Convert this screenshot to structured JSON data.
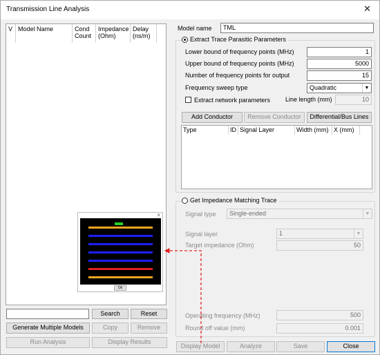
{
  "window": {
    "title": "Transmission Line Analysis",
    "close_glyph": "✕"
  },
  "model_list": {
    "columns": [
      "V",
      "Model Name",
      "Cond Count",
      "Impedance (Ohm)",
      "Delay (ns/m)"
    ]
  },
  "left_controls": {
    "search_value": "",
    "search_label": "Search",
    "reset_label": "Reset",
    "generate_label": "Generate Multiple Models",
    "copy_label": "Copy",
    "remove_label": "Remove",
    "run_label": "Run Analysis",
    "display_results_label": "Display Results"
  },
  "preview": {
    "close_glyph": "×",
    "ok_label": "Ok",
    "trace_colors": [
      "#f5a623",
      "#1f1fff",
      "#1f1fff",
      "#1f1fff",
      "#1f1fff",
      "#e02020",
      "#f5a623"
    ]
  },
  "model": {
    "label": "Model name",
    "value": "TML"
  },
  "extract": {
    "radio_label": "Extract Trace Parasitic Parameters",
    "lower_label": "Lower bound of frequency points (MHz)",
    "lower_value": "1",
    "upper_label": "Upper bound of frequency points (MHz)",
    "upper_value": "5000",
    "count_label": "Number of frequency points for output",
    "count_value": "15",
    "sweep_label": "Frequency sweep type",
    "sweep_value": "Quadratic",
    "network_label": "Extract network parameters",
    "line_length_label": "Line length (mm)",
    "line_length_value": "10",
    "add_conductor": "Add Conductor",
    "remove_conductor": "Remove Conductor",
    "diff_bus": "Differential/Bus Lines",
    "columns": [
      "Type",
      "ID",
      "Signal Layer",
      "Width (mm)",
      "X (mm)"
    ]
  },
  "impedance": {
    "radio_label": "Get Impedance Matching Trace",
    "signal_type_label": "Signal type",
    "signal_type_value": "Single-ended",
    "signal_layer_label": "Signal layer",
    "signal_layer_value": "1",
    "target_label": "Target impedance (Ohm)",
    "target_value": "50",
    "freq_label": "Operating frequency (MHz)",
    "freq_value": "500",
    "roundoff_label": "Round off value (mm)",
    "roundoff_value": "0.001"
  },
  "bottom_buttons": {
    "display_model": "Display Model",
    "analyze": "Analyze",
    "save": "Save",
    "close": "Close"
  }
}
